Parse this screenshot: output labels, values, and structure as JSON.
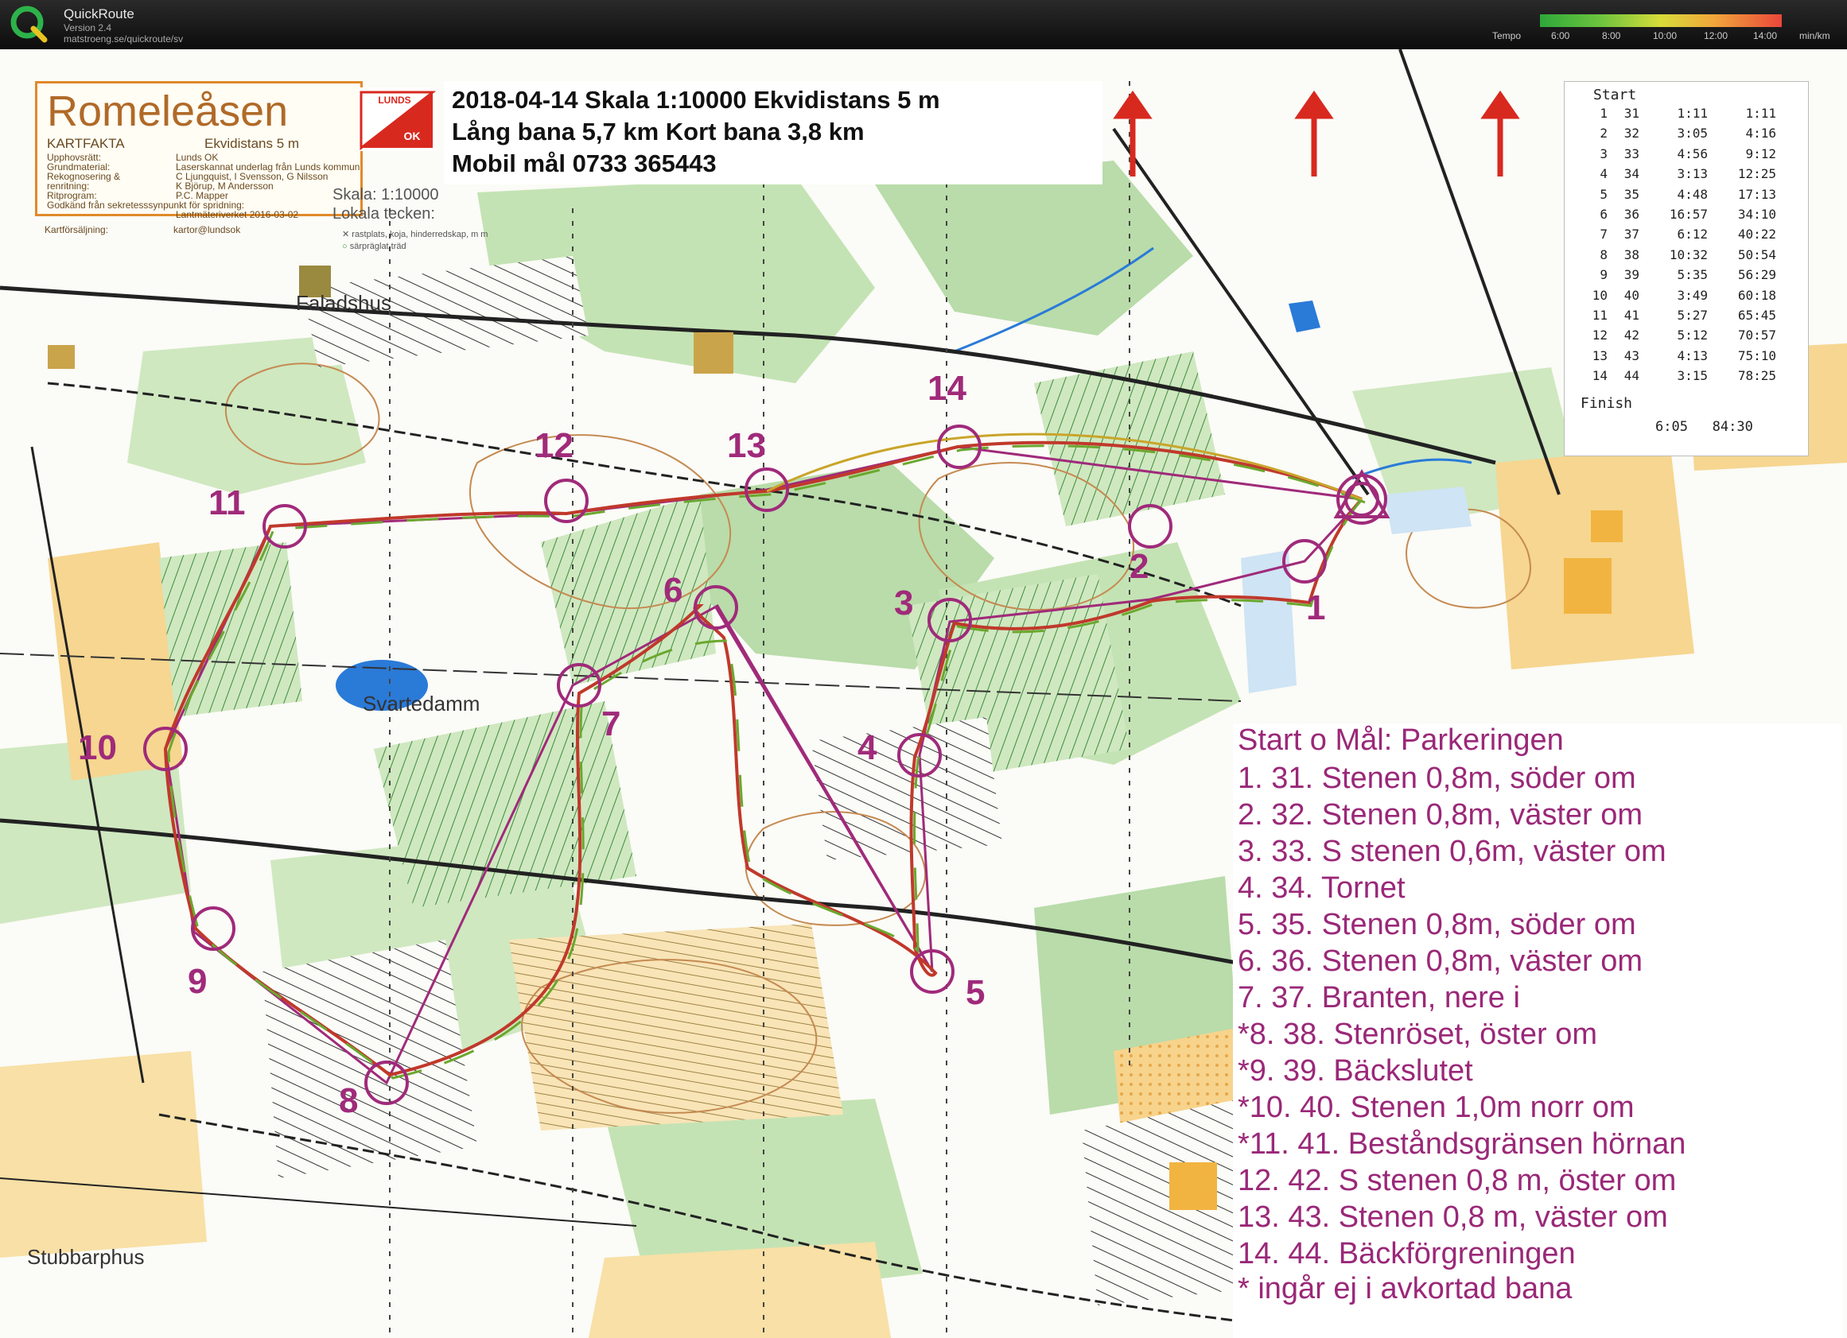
{
  "app": {
    "name": "QuickRoute",
    "version": "Version 2.4",
    "url": "matstroeng.se/quickroute/sv",
    "tempo_label": "Tempo",
    "tempo_ticks": [
      "6:00",
      "8:00",
      "10:00",
      "12:00",
      "14:00"
    ],
    "tempo_unit": "min/km"
  },
  "map": {
    "title": "Romeleåsen",
    "kartfakta": "KARTFAKTA",
    "kartfakta_ekvidistans": "Ekvidistans 5 m",
    "facts": [
      {
        "label": "Upphovsrätt:",
        "value": "Lunds OK"
      },
      {
        "label": "Grundmaterial:",
        "value": "Laserskannat underlag från Lunds kommun"
      },
      {
        "label": "Rekognosering &",
        "value": "C Ljungquist, I Svensson, G Nilsson"
      },
      {
        "label": "renritning:",
        "value": "K Björup, M Andersson"
      },
      {
        "label": "Ritprogram:",
        "value": "P.C. Mapper"
      },
      {
        "label": "Godkänd från sekretesssynpunkt för spridning:",
        "value": ""
      },
      {
        "label": "",
        "value": "Lantmäteriverket 2016-03-02"
      },
      {
        "label": "Kartförsäljning:",
        "value": "kartor@lundsok"
      }
    ],
    "logo_top": "LUNDS",
    "logo_bottom": "OK",
    "scale": "Skala: 1:10000",
    "local_signs": "Lokala tecken:",
    "sign_rest": "rastplats, koja, hinderredskap, m m",
    "sign_tree": "särpräglat träd",
    "header": {
      "line1": "2018-04-14   Skala 1:10000   Ekvidistans 5 m",
      "line2": "Lång bana 5,7 km   Kort bana 3,8 km",
      "line3": "Mobil mål  0733 365443"
    },
    "places": {
      "faladshus": "Faladshus",
      "svartedamm": "Svartedamm",
      "stubbarphus": "Stubbarphus"
    },
    "controls": [
      "1",
      "2",
      "3",
      "4",
      "5",
      "6",
      "7",
      "8",
      "9",
      "10",
      "11",
      "12",
      "13",
      "14"
    ]
  },
  "splits": {
    "start": "Start",
    "rows": [
      {
        "n": "1",
        "code": "31",
        "leg": "1:11",
        "total": "1:11"
      },
      {
        "n": "2",
        "code": "32",
        "leg": "3:05",
        "total": "4:16"
      },
      {
        "n": "3",
        "code": "33",
        "leg": "4:56",
        "total": "9:12"
      },
      {
        "n": "4",
        "code": "34",
        "leg": "3:13",
        "total": "12:25"
      },
      {
        "n": "5",
        "code": "35",
        "leg": "4:48",
        "total": "17:13"
      },
      {
        "n": "6",
        "code": "36",
        "leg": "16:57",
        "total": "34:10"
      },
      {
        "n": "7",
        "code": "37",
        "leg": "6:12",
        "total": "40:22"
      },
      {
        "n": "8",
        "code": "38",
        "leg": "10:32",
        "total": "50:54"
      },
      {
        "n": "9",
        "code": "39",
        "leg": "5:35",
        "total": "56:29"
      },
      {
        "n": "10",
        "code": "40",
        "leg": "3:49",
        "total": "60:18"
      },
      {
        "n": "11",
        "code": "41",
        "leg": "5:27",
        "total": "65:45"
      },
      {
        "n": "12",
        "code": "42",
        "leg": "5:12",
        "total": "70:57"
      },
      {
        "n": "13",
        "code": "43",
        "leg": "4:13",
        "total": "75:10"
      },
      {
        "n": "14",
        "code": "44",
        "leg": "3:15",
        "total": "78:25"
      }
    ],
    "finish": "Finish",
    "finish_leg": "6:05",
    "finish_total": "84:30"
  },
  "descriptions": {
    "title": "Start o Mål: Parkeringen",
    "items": [
      "1. 31. Stenen 0,8m, söder om",
      "2. 32. Stenen 0,8m, väster om",
      "3. 33. S stenen 0,6m, väster om",
      "4. 34. Tornet",
      "5. 35. Stenen 0,8m, söder om",
      "6. 36. Stenen 0,8m, väster om",
      "7. 37. Branten, nere i",
      "*8. 38. Stenröset, öster om",
      "*9. 39. Bäckslutet",
      "*10. 40. Stenen 1,0m norr om",
      "*11. 41. Beståndsgränsen hörnan",
      "12. 42. S stenen 0,8 m, öster om",
      "13. 43. Stenen 0,8 m, väster om",
      "14. 44. Bäckförgreningen"
    ],
    "footnote": "* ingår ej i avkortad bana"
  },
  "colors": {
    "course": "#a02a7a",
    "route": "#c9a52a",
    "forest_green": "#b9dcaa",
    "open_yellow": "#f6d690",
    "water": "#2a7ad8",
    "contour": "#c58a52"
  }
}
